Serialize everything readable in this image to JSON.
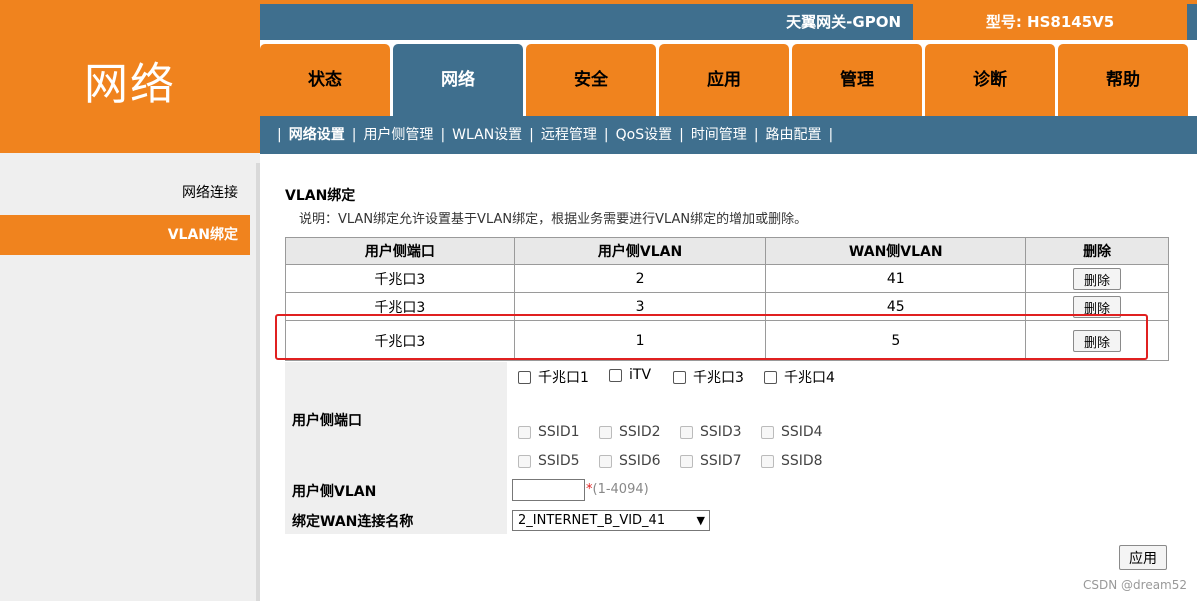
{
  "brand": {
    "title": "网络"
  },
  "header": {
    "gateway_name": "天翼网关-GPON",
    "model": "型号: HS8145V5"
  },
  "tabs": [
    {
      "label": "状态"
    },
    {
      "label": "网络"
    },
    {
      "label": "安全"
    },
    {
      "label": "应用"
    },
    {
      "label": "管理"
    },
    {
      "label": "诊断"
    },
    {
      "label": "帮助"
    }
  ],
  "active_tab": "网络",
  "subnav": {
    "items": [
      {
        "label": "网络设置"
      },
      {
        "label": "用户侧管理"
      },
      {
        "label": "WLAN设置"
      },
      {
        "label": "远程管理"
      },
      {
        "label": "QoS设置"
      },
      {
        "label": "时间管理"
      },
      {
        "label": "路由配置"
      }
    ],
    "separator": "|"
  },
  "sidebar": {
    "items": [
      {
        "label": "网络连接"
      },
      {
        "label": "VLAN绑定"
      }
    ]
  },
  "page": {
    "title": "VLAN绑定",
    "description": "说明：VLAN绑定允许设置基于VLAN绑定，根据业务需要进行VLAN绑定的增加或删除。"
  },
  "table": {
    "headers": [
      "用户侧端口",
      "用户侧VLAN",
      "WAN侧VLAN",
      "删除"
    ],
    "rows": [
      {
        "port": "千兆口3",
        "user_vlan": "2",
        "wan_vlan": "41",
        "action": "删除"
      },
      {
        "port": "千兆口3",
        "user_vlan": "3",
        "wan_vlan": "45",
        "action": "删除"
      },
      {
        "port": "千兆口3",
        "user_vlan": "1",
        "wan_vlan": "5",
        "action": "删除"
      }
    ]
  },
  "form": {
    "port_label": "用户侧端口",
    "lan_ports": [
      "千兆口1",
      "iTV",
      "千兆口3",
      "千兆口4"
    ],
    "ssids_row1": [
      "SSID1",
      "SSID2",
      "SSID3",
      "SSID4"
    ],
    "ssids_row2": [
      "SSID5",
      "SSID6",
      "SSID7",
      "SSID8"
    ],
    "vlan_label": "用户侧VLAN",
    "vlan_value": "",
    "vlan_required_mark": "*",
    "vlan_range_hint": "(1-4094)",
    "wan_label": "绑定WAN连接名称",
    "wan_selected": "2_INTERNET_B_VID_41",
    "apply_label": "应用"
  },
  "watermark": "CSDN @dream52",
  "colors": {
    "orange": "#f0831e",
    "blue": "#3f6f8e",
    "highlight": "#e02020"
  }
}
